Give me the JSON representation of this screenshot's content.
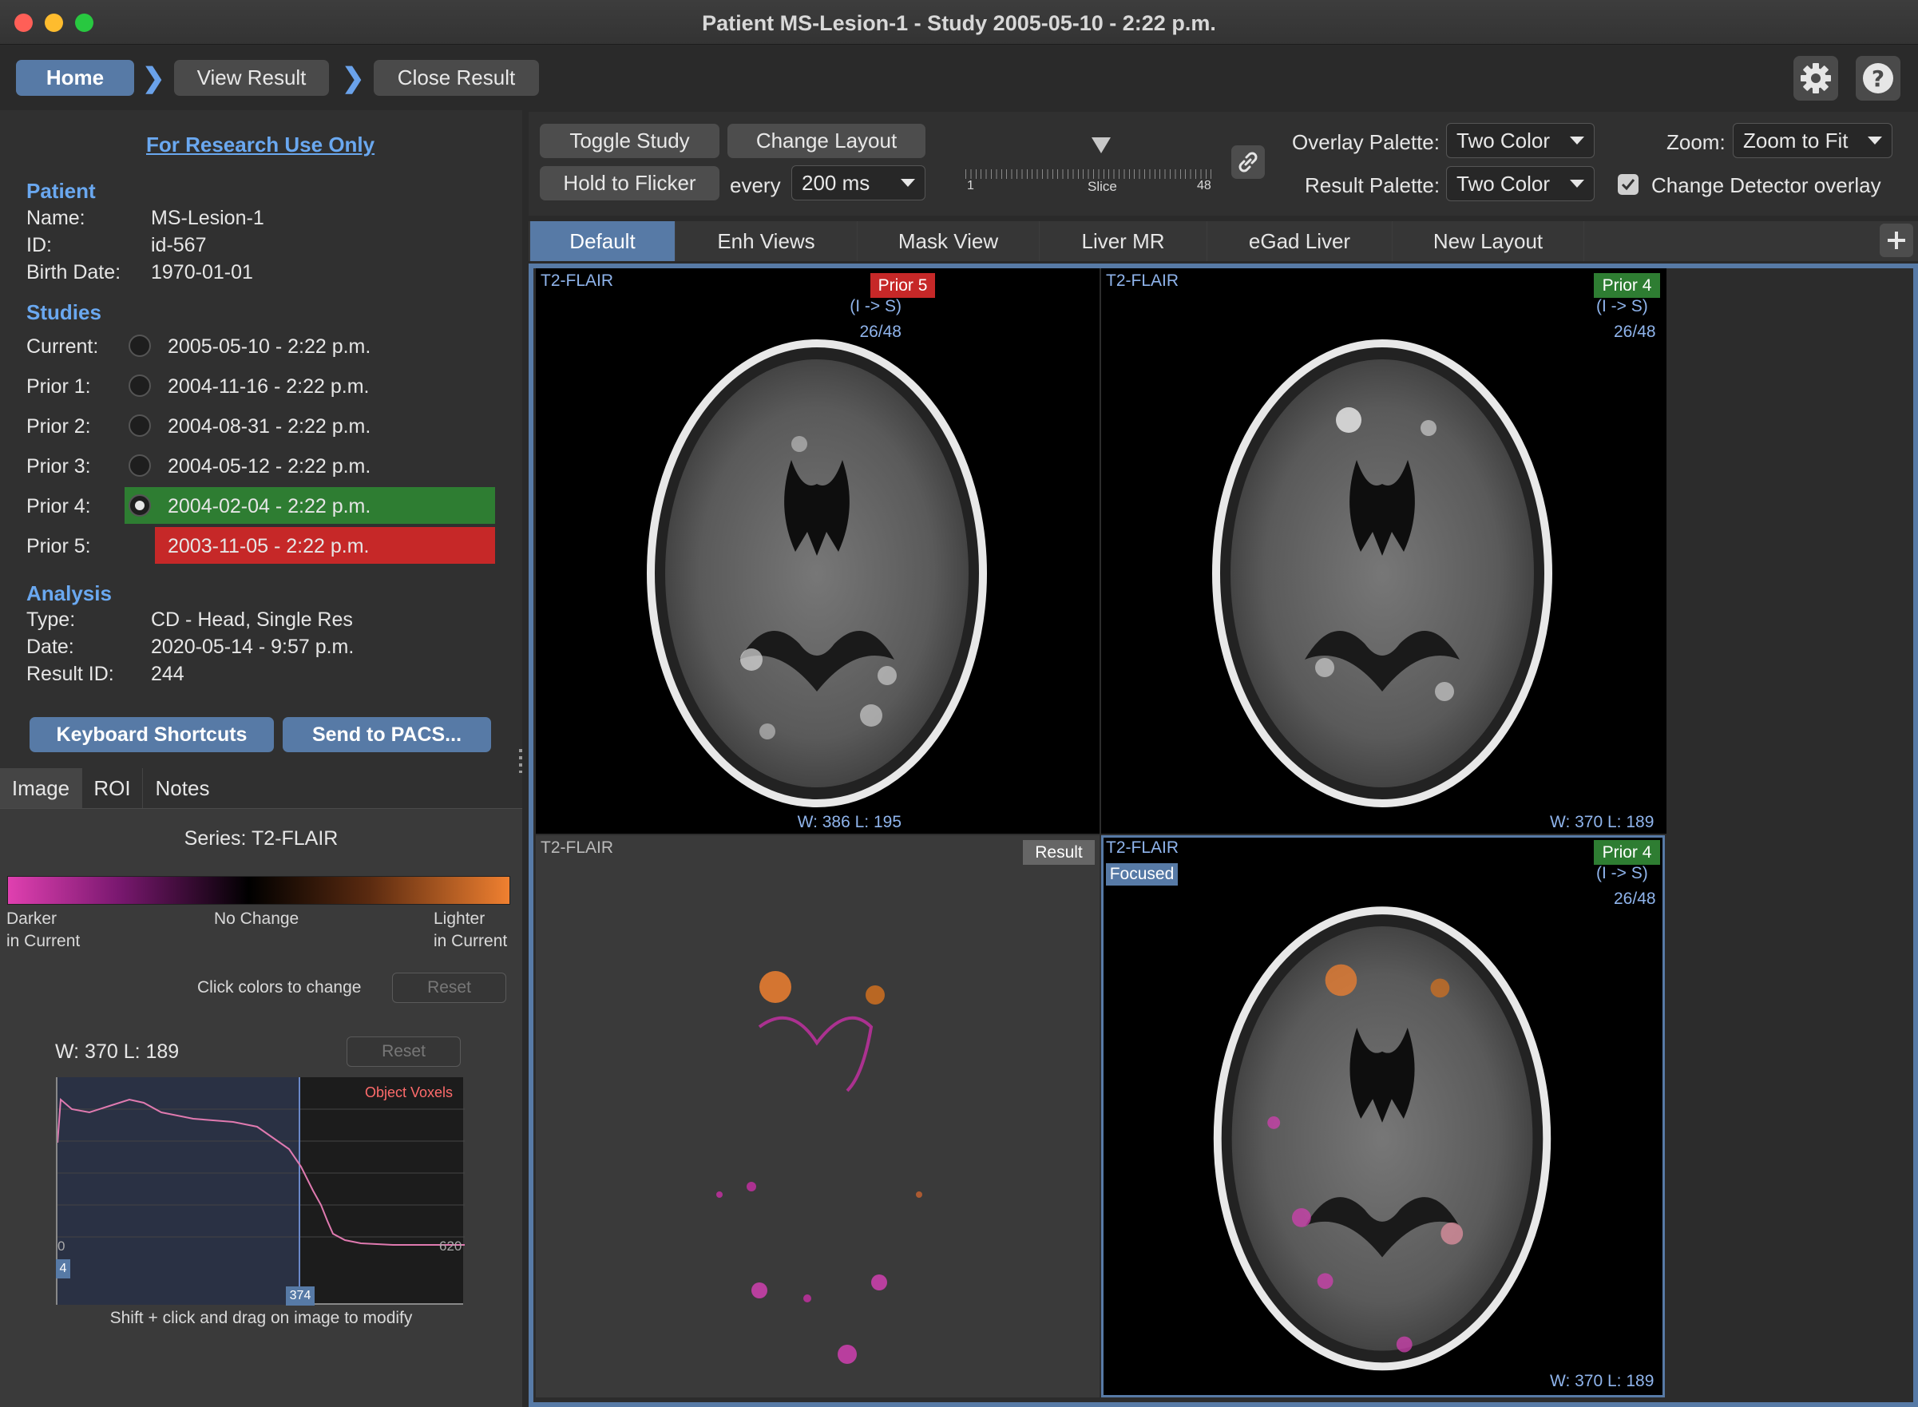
{
  "window": {
    "title": "Patient MS-Lesion-1 - Study 2005-05-10 - 2:22 p.m."
  },
  "nav": {
    "home": "Home",
    "view_result": "View Result",
    "close_result": "Close Result",
    "chevron": "❯"
  },
  "icons": {
    "gear": "gear-icon",
    "help": "help-icon",
    "link": "link-icon",
    "add": "plus-icon"
  },
  "notice": "For Research Use Only",
  "patient": {
    "heading": "Patient",
    "name_label": "Name:",
    "name": "MS-Lesion-1",
    "id_label": "ID:",
    "id": "id-567",
    "birth_label": "Birth Date:",
    "birth": "1970-01-01"
  },
  "studies": {
    "heading": "Studies",
    "items": [
      {
        "label": "Current:",
        "date": "2005-05-10 - 2:22 p.m."
      },
      {
        "label": "Prior 1:",
        "date": "2004-11-16 - 2:22 p.m."
      },
      {
        "label": "Prior 2:",
        "date": "2004-08-31 - 2:22 p.m."
      },
      {
        "label": "Prior 3:",
        "date": "2004-05-12 - 2:22 p.m."
      },
      {
        "label": "Prior 4:",
        "date": "2004-02-04 - 2:22 p.m."
      },
      {
        "label": "Prior 5:",
        "date": "2003-11-05 - 2:22 p.m."
      }
    ]
  },
  "analysis": {
    "heading": "Analysis",
    "type_label": "Type:",
    "type": "CD - Head, Single Res",
    "date_label": "Date:",
    "date": "2020-05-14 - 9:57 p.m.",
    "result_label": "Result ID:",
    "result": "244"
  },
  "actions": {
    "shortcuts": "Keyboard Shortcuts",
    "pacs": "Send to PACS..."
  },
  "subtabs": [
    "Image",
    "ROI",
    "Notes"
  ],
  "image_panel": {
    "series": "Series:  T2-FLAIR",
    "darker": "Darker",
    "darker2": "in Current",
    "nochange": "No Change",
    "lighter": "Lighter",
    "lighter2": "in Current",
    "click_colors": "Click colors to change",
    "reset": "Reset",
    "wl": "W: 370 L: 189",
    "hist_title": "Object Voxels",
    "hist_min": "0",
    "hist_max": "620",
    "marker_low": "4",
    "marker_high": "374",
    "hint": "Shift + click and drag on image to modify"
  },
  "toolbar": {
    "toggle": "Toggle Study",
    "change_layout": "Change Layout",
    "hold": "Hold to Flicker",
    "every": "every",
    "interval": "200 ms",
    "slice_min": "1",
    "slice_label": "Slice",
    "slice_max": "48",
    "overlay_label": "Overlay Palette:",
    "overlay_value": "Two Color",
    "result_label": "Result Palette:",
    "result_value": "Two Color",
    "zoom_label": "Zoom:",
    "zoom_value": "Zoom to Fit",
    "cd_overlay": "Change Detector overlay"
  },
  "view_tabs": [
    "Default",
    "Enh Views",
    "Mask View",
    "Liver MR",
    "eGad Liver",
    "New Layout"
  ],
  "viewports": {
    "tl": {
      "series": "T2-FLAIR",
      "badge": "Prior 5",
      "orient": "(I -> S)",
      "slice": "26/48",
      "wl": "W: 386 L: 195"
    },
    "tr": {
      "series": "T2-FLAIR",
      "badge": "Prior 4",
      "orient": "(I -> S)",
      "slice": "26/48",
      "wl": "W: 370 L: 189"
    },
    "bl": {
      "series": "T2-FLAIR",
      "badge": "Result"
    },
    "br": {
      "series": "T2-FLAIR",
      "focused": "Focused",
      "badge": "Prior 4",
      "orient": "(I -> S)",
      "slice": "26/48",
      "wl": "W: 370 L: 189"
    }
  },
  "colors": {
    "accent": "#577aa6",
    "link": "#6aa8f0",
    "prior4": "#2e7d32",
    "prior5": "#c62828",
    "darker": "#e040b0",
    "lighter": "#f08030"
  }
}
